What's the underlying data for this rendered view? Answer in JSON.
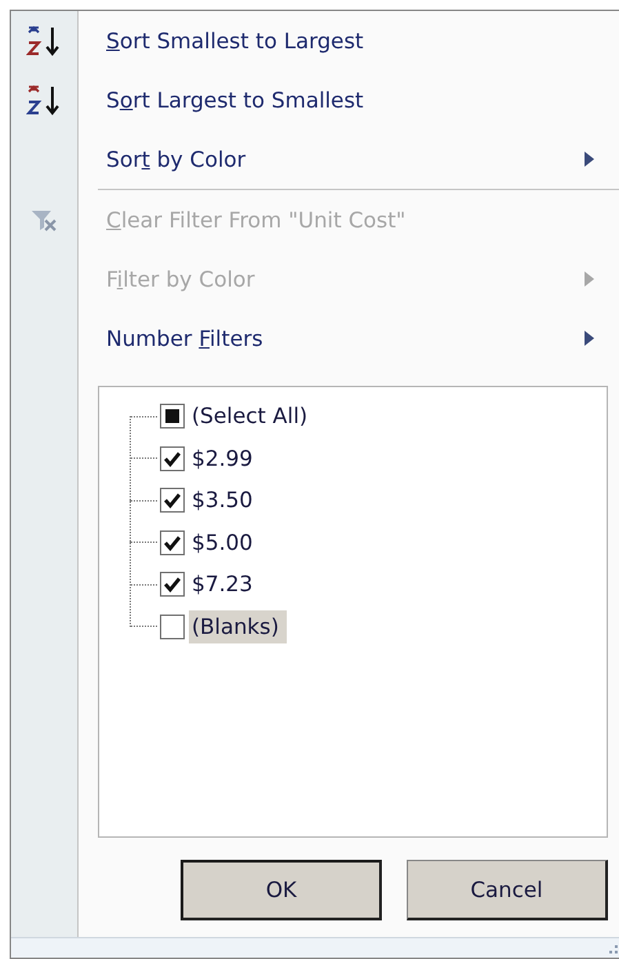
{
  "menu_items": [
    {
      "kind": "sort-ascending",
      "key": "S",
      "post": "ort Smallest to Largest",
      "disabled": false,
      "submenu": false
    },
    {
      "kind": "sort-descending",
      "pre": "S",
      "key": "o",
      "post": "rt Largest to Smallest",
      "disabled": false,
      "submenu": false
    },
    {
      "kind": "plain",
      "pre": "Sor",
      "key": "t",
      "post": " by Color",
      "disabled": false,
      "submenu": true
    },
    {
      "kind": "separator"
    },
    {
      "kind": "clear-filter",
      "key": "C",
      "post": "lear Filter From \"Unit Cost\"",
      "disabled": true,
      "submenu": false
    },
    {
      "kind": "plain",
      "pre": "F",
      "key": "i",
      "post": "lter by Color",
      "disabled": true,
      "submenu": true
    },
    {
      "kind": "plain",
      "pre": "Number ",
      "key": "F",
      "post": "ilters",
      "disabled": false,
      "submenu": true
    }
  ],
  "values": [
    {
      "label": "(Select All)",
      "checked": true,
      "partial": true,
      "selected": false
    },
    {
      "label": "$2.99",
      "checked": true,
      "selected": false
    },
    {
      "label": "$3.50",
      "checked": true,
      "selected": false
    },
    {
      "label": "$5.00",
      "checked": true,
      "selected": false
    },
    {
      "label": "$7.23",
      "checked": true,
      "selected": false
    },
    {
      "label": "(Blanks)",
      "checked": false,
      "selected": true
    }
  ],
  "buttons": [
    {
      "label": "OK",
      "default": true
    },
    {
      "label": "Cancel",
      "default": false
    }
  ]
}
